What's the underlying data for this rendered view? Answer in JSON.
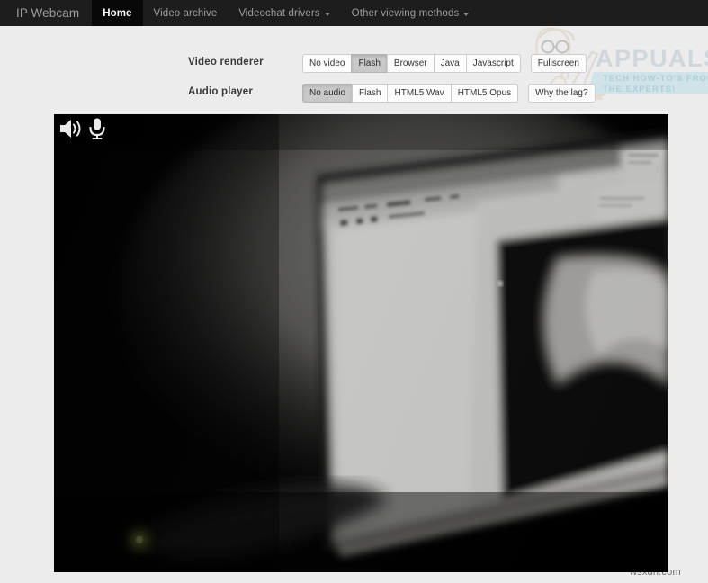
{
  "navbar": {
    "brand": "IP Webcam",
    "items": [
      {
        "label": "Home",
        "active": true,
        "caret": false
      },
      {
        "label": "Video archive",
        "active": false,
        "caret": false
      },
      {
        "label": "Videochat drivers",
        "active": false,
        "caret": true
      },
      {
        "label": "Other viewing methods",
        "active": false,
        "caret": true
      }
    ]
  },
  "controls": {
    "video_renderer": {
      "label": "Video renderer",
      "buttons": [
        {
          "label": "No video",
          "active": false
        },
        {
          "label": "Flash",
          "active": true
        },
        {
          "label": "Browser",
          "active": false
        },
        {
          "label": "Java",
          "active": false
        },
        {
          "label": "Javascript",
          "active": false
        }
      ],
      "standalone": {
        "label": "Fullscreen",
        "active": false
      }
    },
    "audio_player": {
      "label": "Audio player",
      "buttons": [
        {
          "label": "No audio",
          "active": true
        },
        {
          "label": "Flash",
          "active": false
        },
        {
          "label": "HTML5 Wav",
          "active": false
        },
        {
          "label": "HTML5 Opus",
          "active": false
        }
      ],
      "standalone": {
        "label": "Why the lag?",
        "active": false
      }
    }
  },
  "video": {
    "speaker_icon": "speaker-volume-icon",
    "mic_icon": "microphone-icon",
    "description": "Dark live camera view of a desk with a brightly lit computer monitor"
  },
  "watermark": {
    "title": "APPUALS",
    "tagline_line1": "TECH HOW-TO'S FROM",
    "tagline_line2": "THE EXPERTS!",
    "icon": "person-with-laptop-icon"
  },
  "footer": {
    "credit": "wsxdn.com"
  },
  "colors": {
    "navbar_bg": "#1d1d1d",
    "active_tab_bg": "#080808",
    "page_bg": "#ececec",
    "button_active_bg": "#c9c9c9",
    "video_bg": "#000000"
  }
}
